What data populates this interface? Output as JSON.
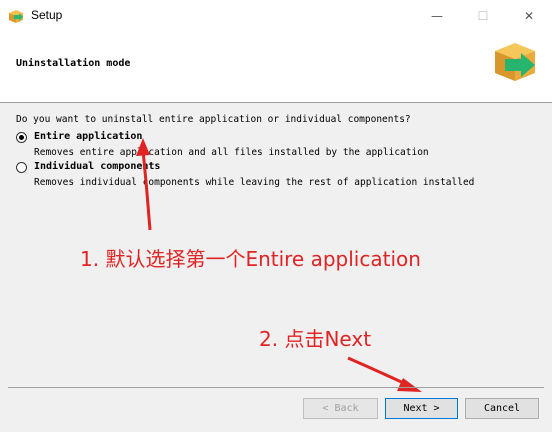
{
  "window": {
    "title": "Setup",
    "minimize_glyph": "—",
    "maximize_glyph": "☐",
    "close_glyph": "✕"
  },
  "header": {
    "title": "Uninstallation mode"
  },
  "question": "Do you want to uninstall entire application or individual components?",
  "options": [
    {
      "label": "Entire application",
      "description": "Removes entire application and all files installed by the application",
      "selected": true
    },
    {
      "label": "Individual components",
      "description": "Removes individual components while leaving the rest of application installed",
      "selected": false
    }
  ],
  "annotations": {
    "step1": "1. 默认选择第一个Entire application",
    "step2": "2. 点击Next",
    "color": "#e02323"
  },
  "buttons": {
    "back": "< Back",
    "next": "Next >",
    "cancel": "Cancel"
  }
}
